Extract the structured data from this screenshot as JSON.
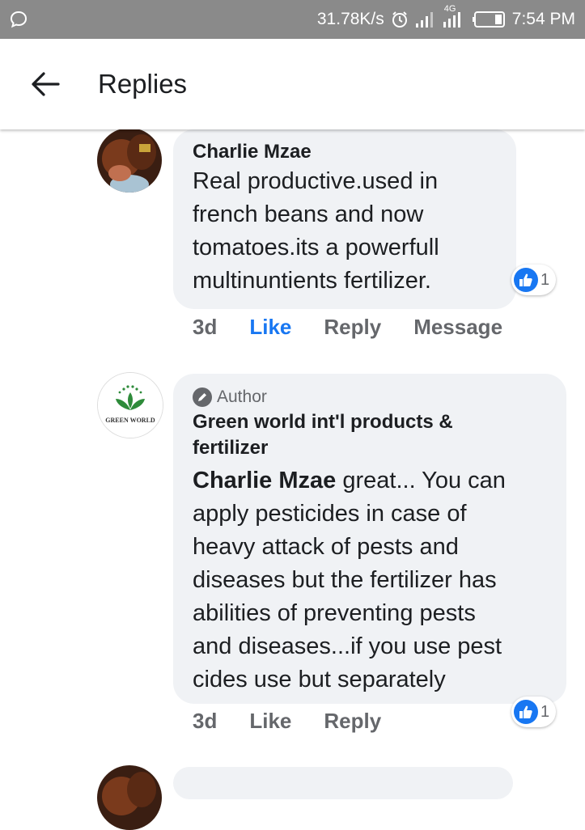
{
  "status_bar": {
    "speed": "31.78K/s",
    "network": "4G",
    "time": "7:54 PM"
  },
  "header": {
    "title": "Replies"
  },
  "comments": [
    {
      "author": "Charlie Mzae",
      "lines": [
        "Real productive.used in",
        "french beans and now",
        "tomatoes.its a powerfull",
        "multinuntients fertilizer."
      ],
      "reaction_count": "1",
      "actions": {
        "time": "3d",
        "like": "Like",
        "reply": "Reply",
        "message": "Message"
      }
    },
    {
      "badge": "Author",
      "author_lines": [
        "Green world int'l products &",
        "fertilizer"
      ],
      "avatar_text": "GREEN WORLD",
      "mention": "Charlie Mzae",
      "first_line_rest": " great... You can",
      "lines": [
        "apply pesticides in case of",
        "heavy attack of pests and",
        "diseases but the fertilizer has",
        "abilities of preventing pests",
        "and diseases...if you use pest",
        "cides use but separately"
      ],
      "reaction_count": "1",
      "actions": {
        "time": "3d",
        "like": "Like",
        "reply": "Reply"
      }
    }
  ]
}
